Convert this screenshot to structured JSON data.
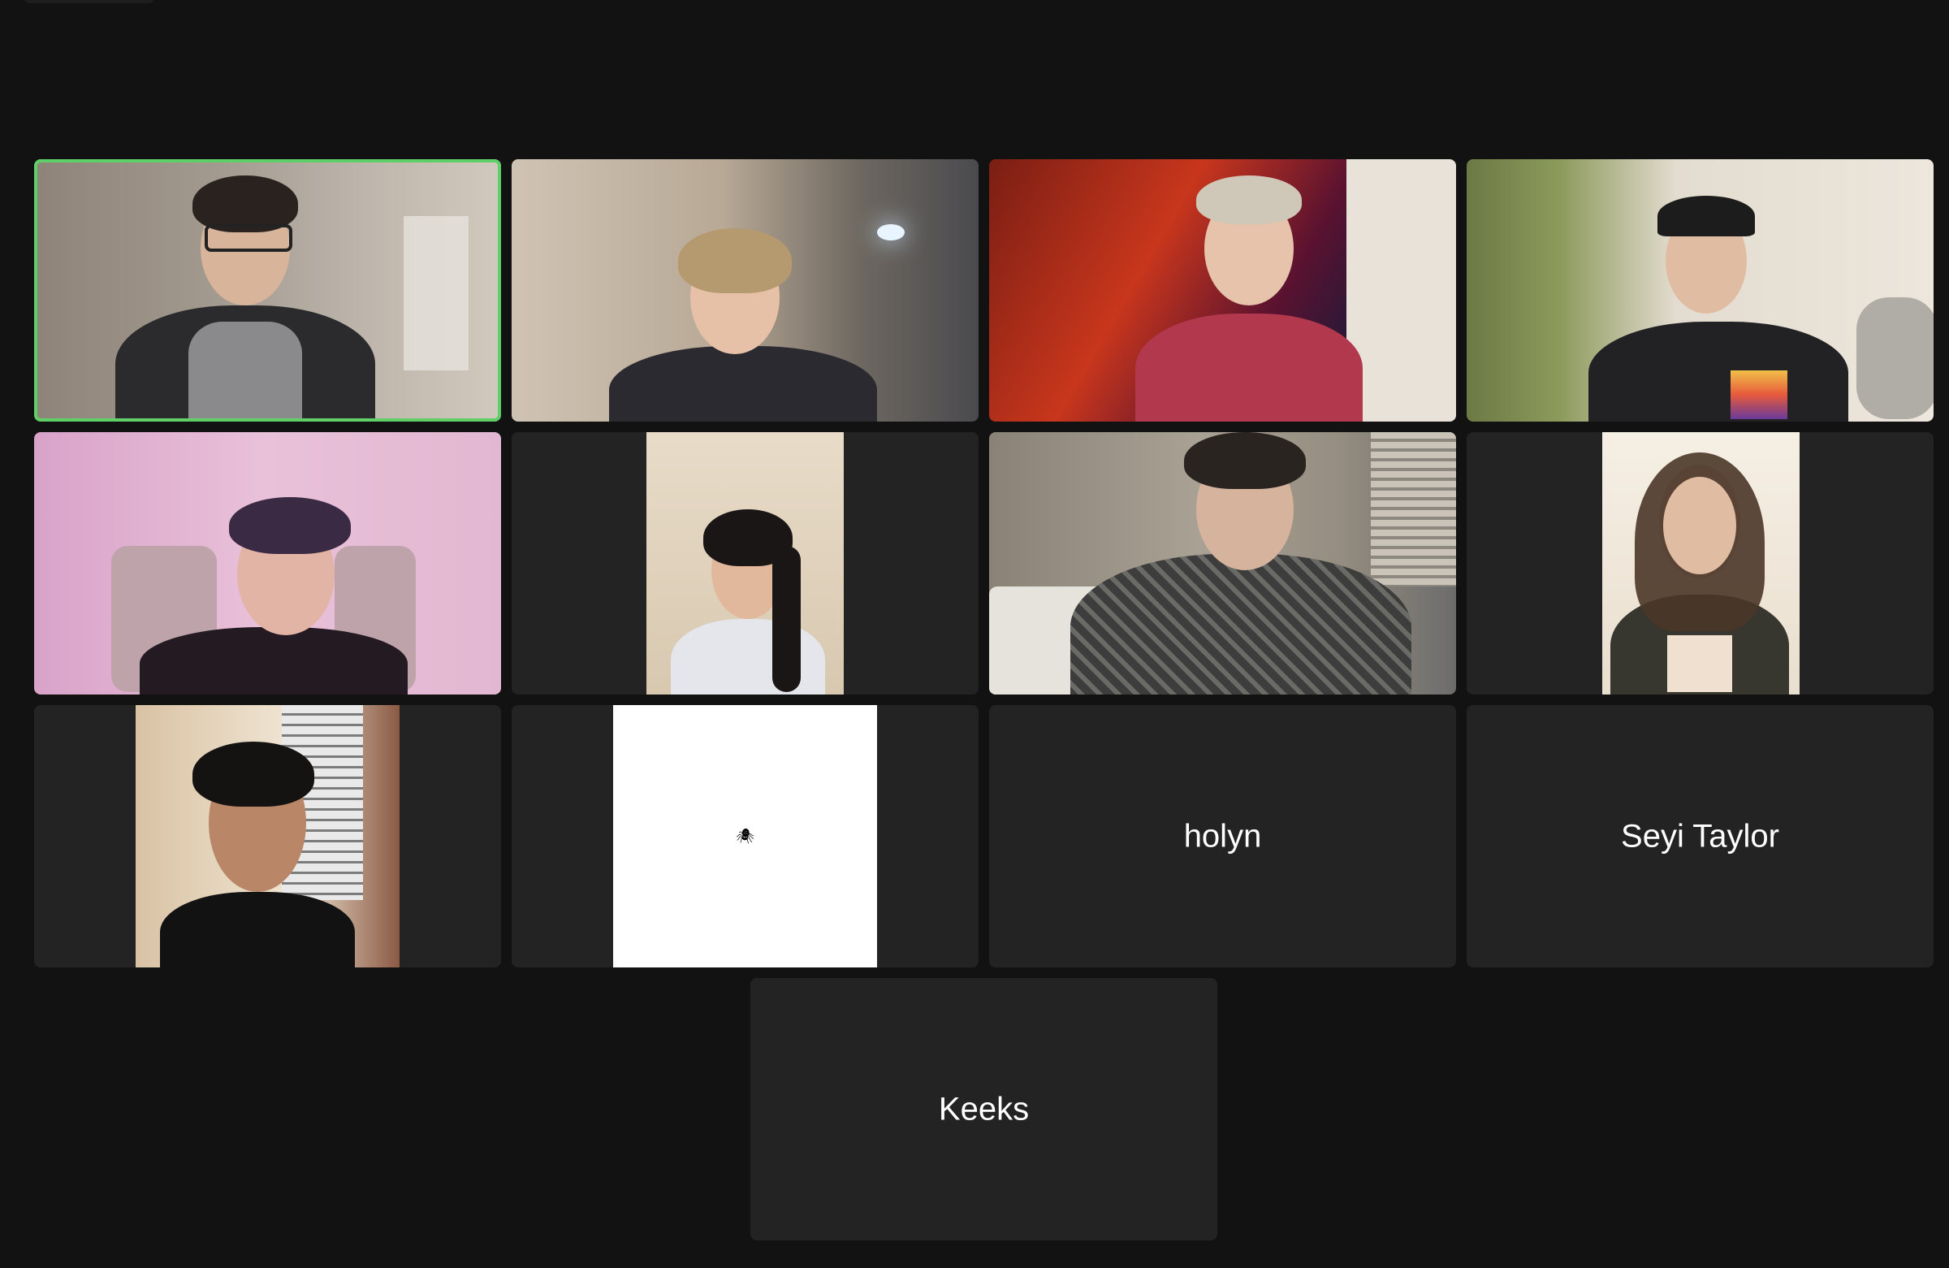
{
  "meeting": {
    "layout": "gallery-view"
  },
  "participants": [
    {
      "id": "p1",
      "type": "video",
      "speaking": true
    },
    {
      "id": "p2",
      "type": "video",
      "speaking": false
    },
    {
      "id": "p3",
      "type": "video",
      "speaking": false
    },
    {
      "id": "p4",
      "type": "video",
      "speaking": false
    },
    {
      "id": "p5",
      "type": "video",
      "speaking": false
    },
    {
      "id": "p6",
      "type": "video",
      "speaking": false
    },
    {
      "id": "p7",
      "type": "video",
      "speaking": false
    },
    {
      "id": "p8",
      "type": "video",
      "speaking": false
    },
    {
      "id": "p9",
      "type": "video",
      "speaking": false
    },
    {
      "id": "p10",
      "type": "image",
      "speaking": false,
      "icon": "bug-icon"
    },
    {
      "id": "p11",
      "type": "name",
      "name": "holyn",
      "speaking": false
    },
    {
      "id": "p12",
      "type": "name",
      "name": "Seyi Taylor",
      "speaking": false
    },
    {
      "id": "p13",
      "type": "name",
      "name": "Keeks",
      "speaking": false
    }
  ],
  "colors": {
    "background": "#121212",
    "tile": "#232323",
    "active_speaker_border": "#5fd068",
    "name_text": "#ffffff"
  }
}
